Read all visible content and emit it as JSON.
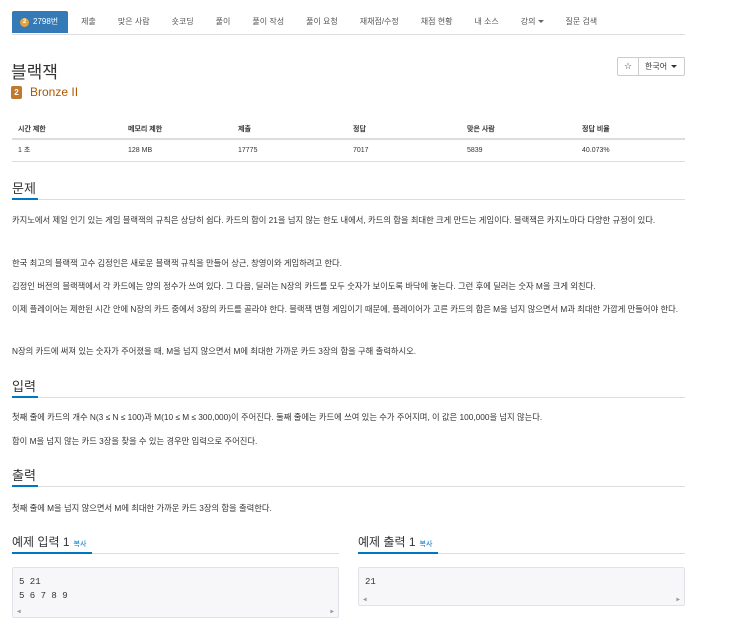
{
  "nav": {
    "tabs": [
      {
        "label": "2798번",
        "active": true
      },
      {
        "label": "제출"
      },
      {
        "label": "맞은 사람"
      },
      {
        "label": "숏코딩"
      },
      {
        "label": "풀이"
      },
      {
        "label": "풀이 작성"
      },
      {
        "label": "풀이 요청"
      },
      {
        "label": "재채점/수정"
      },
      {
        "label": "채점 현황"
      },
      {
        "label": "내 소스"
      },
      {
        "label": "강의"
      },
      {
        "label": "질문 검색"
      }
    ],
    "tier_mini": "2"
  },
  "problem": {
    "title": "블랙잭",
    "tier_number": "2",
    "tier_label": "Bronze II",
    "star_icon": "☆",
    "language": "한국어"
  },
  "stats": {
    "headers": [
      "시간 제한",
      "메모리 제한",
      "제출",
      "정답",
      "맞은 사람",
      "정답 비율"
    ],
    "values": [
      "1 초",
      "128 MB",
      "17775",
      "7017",
      "5839",
      "40.073%"
    ]
  },
  "sections": {
    "problem_title": "문제",
    "problem_paragraphs": [
      "카지노에서 제일 인기 있는 게임 블랙잭의 규칙은 상당히 쉽다. 카드의 합이 21을 넘지 않는 한도 내에서, 카드의 합을 최대한 크게 만드는 게임이다. 블랙잭은 카지노마다 다양한 규정이 있다.",
      "한국 최고의 블랙잭 고수 김정인은 새로운 블랙잭 규칙을 만들어 상근, 창영이와 게임하려고 한다.",
      "김정인 버전의 블랙잭에서 각 카드에는 양의 정수가 쓰여 있다. 그 다음, 딜러는 N장의 카드를 모두 숫자가 보이도록 바닥에 놓는다. 그런 후에 딜러는 숫자 M을 크게 외친다.",
      "이제 플레이어는 제한된 시간 안에 N장의 카드 중에서 3장의 카드를 골라야 한다. 블랙잭 변형 게임이기 때문에, 플레이어가 고른 카드의 합은 M을 넘지 않으면서 M과 최대한 가깝게 만들어야 한다.",
      "N장의 카드에 써져 있는 숫자가 주어졌을 때, M을 넘지 않으면서 M에 최대한 가까운 카드 3장의 합을 구해 출력하시오."
    ],
    "input_title": "입력",
    "input_paragraphs": [
      "첫째 줄에 카드의 개수 N(3 ≤ N ≤ 100)과 M(10 ≤ M ≤ 300,000)이 주어진다. 둘째 줄에는 카드에 쓰여 있는 수가 주어지며, 이 값은 100,000을 넘지 않는다.",
      "합이 M을 넘지 않는 카드 3장을 찾을 수 있는 경우만 입력으로 주어진다."
    ],
    "output_title": "출력",
    "output_paragraphs": [
      "첫째 줄에 M을 넘지 않으면서 M에 최대한 가까운 카드 3장의 합을 출력한다."
    ]
  },
  "samples": {
    "input_title": "예제 입력 1",
    "output_title": "예제 출력 1",
    "copy_label": "복사",
    "input_text": "5 21\n5 6 7 8 9",
    "output_text": "21"
  }
}
